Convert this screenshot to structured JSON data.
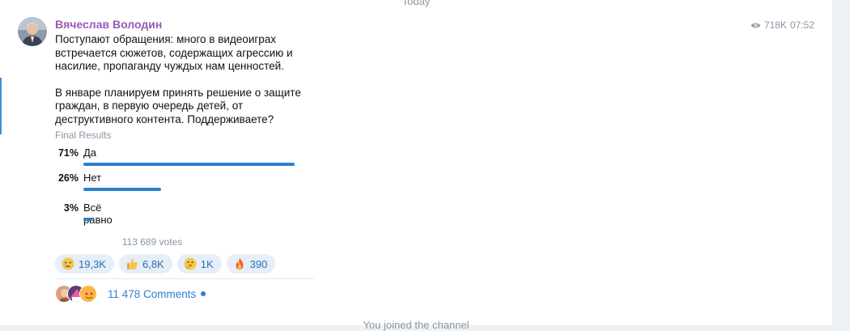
{
  "date_separator": "Today",
  "post": {
    "author": "Вячеслав Володин",
    "views": "718K",
    "time": "07:52",
    "text_paragraphs": [
      "Поступают обращения: много в видеоиграх встречается сюжетов, содержащих агрессию и насилие, пропаганду чуждых нам ценностей.",
      "В январе планируем принять решение о защите граждан, в первую очередь детей, от деструктивного контента. Поддерживаете?"
    ]
  },
  "poll": {
    "status": "Final Results",
    "options": [
      {
        "percent": "71%",
        "label": "Да",
        "value": 71
      },
      {
        "percent": "26%",
        "label": "Нет",
        "value": 26
      },
      {
        "percent": "3%",
        "label": "Всё равно",
        "value": 3
      }
    ],
    "votes": "113 689 votes"
  },
  "reactions": [
    {
      "icon": "crying-face-icon",
      "count": "19,3K"
    },
    {
      "icon": "thumbs-up-icon",
      "count": "6,8K"
    },
    {
      "icon": "thinking-face-icon",
      "count": "1K"
    },
    {
      "icon": "fire-icon",
      "count": "390"
    }
  ],
  "comments": {
    "label": "11 478 Comments"
  },
  "footer_notice": "You joined the channel",
  "colors": {
    "accent": "#2b80cf",
    "author": "#9b59b6",
    "muted": "#8a96a3",
    "reaction_bg": "#e6eef7"
  }
}
